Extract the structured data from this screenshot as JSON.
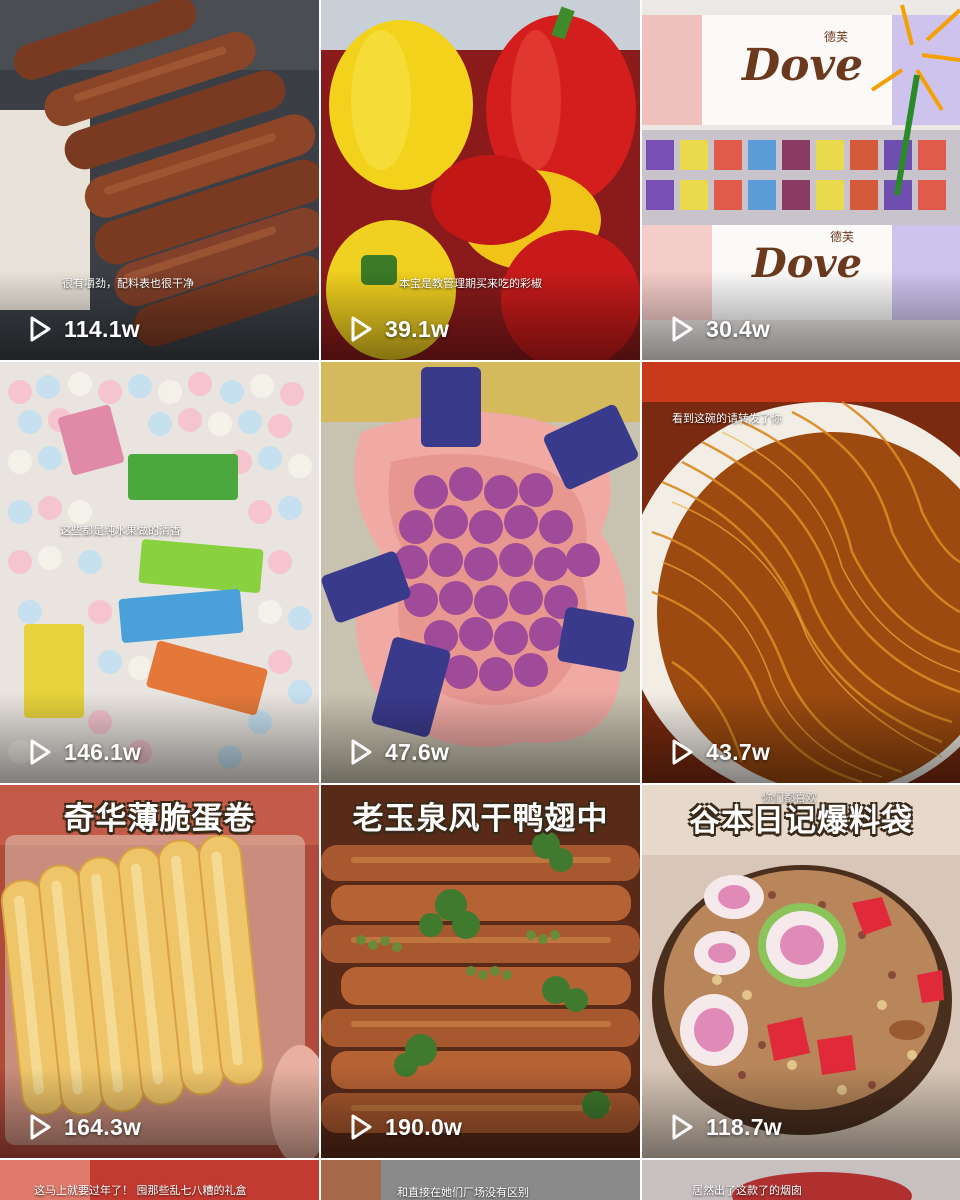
{
  "feed": {
    "items": [
      {
        "plays": "114.1w",
        "caption": "很有嚼劲，配料表也很干净"
      },
      {
        "plays": "39.1w",
        "caption": "本宝是教管理期买来吃的彩椒"
      },
      {
        "plays": "30.4w",
        "brand": "Dove",
        "brand_cn": "德芙"
      },
      {
        "plays": "146.1w",
        "caption": "这些都是纯水果做的清香"
      },
      {
        "plays": "47.6w"
      },
      {
        "plays": "43.7w",
        "caption": "看到这碗的请转发了你"
      },
      {
        "plays": "164.3w",
        "title": "奇华薄脆蛋卷"
      },
      {
        "plays": "190.0w",
        "title": "老玉泉风干鸭翅中"
      },
      {
        "plays": "118.7w",
        "title": "谷本日记爆料袋",
        "caption": "你们都喜欢"
      },
      {
        "caption": "这马上就要过年了！ 囤那些乱七八糟的礼盒"
      },
      {
        "caption": "和直接在她们厂场没有区别"
      },
      {
        "caption": "居然出了这款了的烟囱"
      }
    ]
  },
  "icons": {
    "play": "play-icon"
  },
  "colors": {
    "divider": "#ffffff",
    "count_text": "#ffffff"
  }
}
